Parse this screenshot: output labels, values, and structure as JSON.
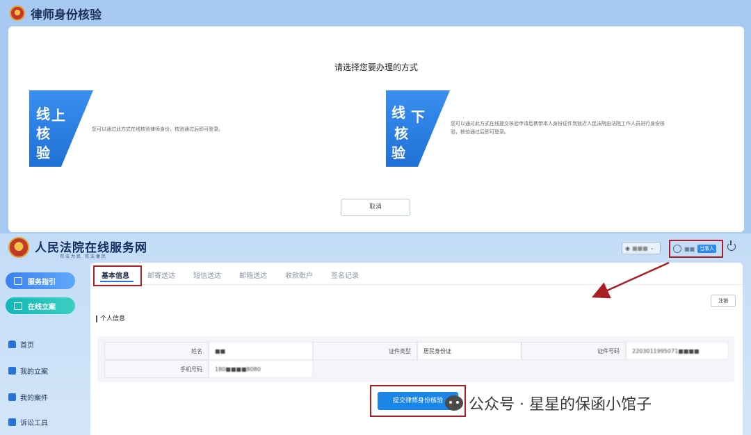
{
  "top": {
    "title": "律师身份核验",
    "dialog_title": "请选择您要办理的方式",
    "online": {
      "badge_chars": [
        "线",
        "上",
        "核",
        "验"
      ],
      "description": "您可以通过此方式在线核验律师身份，核验通过后即可登录。"
    },
    "offline": {
      "badge_chars": [
        "线",
        "下",
        "核",
        "验"
      ],
      "description_line1": "您可以通过此方式在线提交核验申请后携带本人身份证件到就近人民法院由法院工作人员进行身份核",
      "description_line2": "验，核验通过后即可登录。"
    },
    "cancel_label": "取消"
  },
  "app": {
    "site_name": "人民法院在线服务网",
    "slogan": "司法为民  司法便民",
    "location_value": "■■■",
    "user_name": "■■",
    "user_role": "当事人",
    "sidebar": {
      "primary_buttons": [
        "服务指引",
        "在线立案"
      ],
      "items": [
        "首页",
        "我的立案",
        "我的案件",
        "诉讼工具"
      ]
    },
    "tabs": [
      "基本信息",
      "邮寄送达",
      "短信送达",
      "邮箱送达",
      "收款账户",
      "签名记录"
    ],
    "logout_label": "注销",
    "section_title": "个人信息",
    "info": {
      "name_label": "姓名",
      "name_value": "■■",
      "id_type_label": "证件类型",
      "id_type_value": "居民身份证",
      "id_number_label": "证件号码",
      "id_number_value": "2203011995071■■■■",
      "phone_label": "手机号码",
      "phone_value": "180■■■■8080"
    },
    "submit_label": "提交律师身份核验"
  },
  "watermark": "公众号 · 星星的保函小馆子",
  "colors": {
    "accent": "#1a86e8",
    "highlight_box": "#a81f26",
    "badge_blue": "#2f86ee"
  }
}
